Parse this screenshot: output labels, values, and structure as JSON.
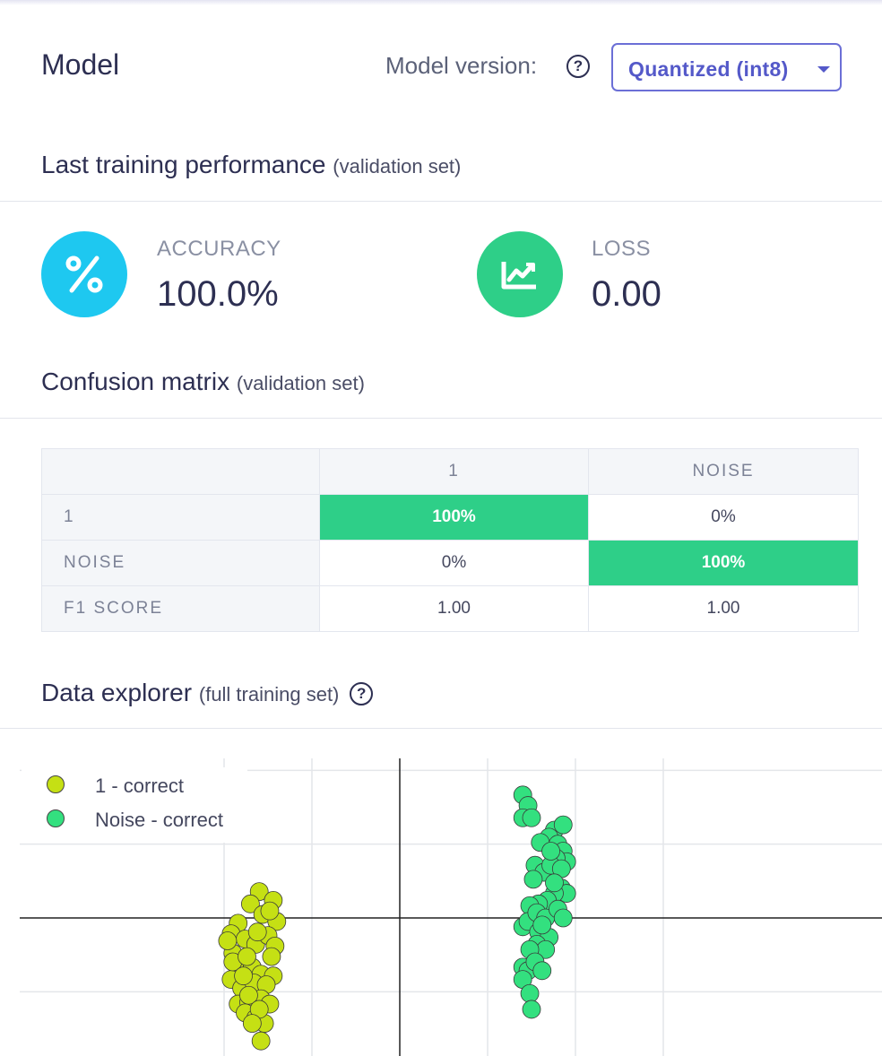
{
  "header": {
    "title": "Model",
    "model_version_label": "Model version:",
    "model_version_value": "Quantized (int8)"
  },
  "performance": {
    "title": "Last training performance",
    "subtitle": "(validation set)",
    "accuracy": {
      "label": "ACCURACY",
      "value": "100.0%",
      "icon": "percent-icon",
      "color": "#1ec8f0"
    },
    "loss": {
      "label": "LOSS",
      "value": "0.00",
      "icon": "trend-chart-icon",
      "color": "#2ecf88"
    }
  },
  "confusion_matrix": {
    "title": "Confusion matrix",
    "subtitle": "(validation set)",
    "columns": [
      "",
      "1",
      "NOISE"
    ],
    "rows": [
      {
        "label": "1",
        "values": [
          "100%",
          "0%"
        ]
      },
      {
        "label": "NOISE",
        "values": [
          "0%",
          "100%"
        ]
      },
      {
        "label": "F1 SCORE",
        "values": [
          "1.00",
          "1.00"
        ]
      }
    ],
    "highlight_color": "#2ecf88"
  },
  "data_explorer": {
    "title": "Data explorer",
    "subtitle": "(full training set)",
    "legend": [
      {
        "label": "1 - correct",
        "color": "#c5e014"
      },
      {
        "label": "Noise - correct",
        "color": "#33e07f"
      }
    ]
  },
  "chart_data": {
    "type": "scatter",
    "grid": true,
    "legend_position": "top-left",
    "series": [
      {
        "name": "1 - correct",
        "color": "#c5e014",
        "points": [
          [
            -0.8,
            0.15
          ],
          [
            -0.72,
            0.1
          ],
          [
            -0.85,
            0.08
          ],
          [
            -0.78,
            0.02
          ],
          [
            -0.7,
            -0.02
          ],
          [
            -0.92,
            -0.03
          ],
          [
            -0.96,
            -0.09
          ],
          [
            -0.88,
            -0.12
          ],
          [
            -0.82,
            -0.15
          ],
          [
            -0.75,
            -0.1
          ],
          [
            -0.71,
            -0.16
          ],
          [
            -0.73,
            -0.22
          ],
          [
            -0.95,
            -0.2
          ],
          [
            -0.91,
            -0.28
          ],
          [
            -0.84,
            -0.28
          ],
          [
            -0.79,
            -0.32
          ],
          [
            -0.72,
            -0.33
          ],
          [
            -0.96,
            -0.35
          ],
          [
            -0.9,
            -0.4
          ],
          [
            -0.83,
            -0.37
          ],
          [
            -0.76,
            -0.38
          ],
          [
            -0.92,
            -0.49
          ],
          [
            -0.86,
            -0.48
          ],
          [
            -0.79,
            -0.46
          ],
          [
            -0.74,
            -0.49
          ],
          [
            -0.88,
            -0.54
          ],
          [
            -0.82,
            -0.57
          ],
          [
            -0.77,
            -0.6
          ],
          [
            -0.79,
            -0.7
          ],
          [
            -0.86,
            -0.44
          ],
          [
            -0.95,
            -0.25
          ],
          [
            -0.87,
            -0.22
          ],
          [
            -0.81,
            -0.08
          ],
          [
            -0.74,
            0.04
          ],
          [
            -0.98,
            -0.13
          ],
          [
            -0.89,
            -0.33
          ],
          [
            -0.8,
            -0.52
          ],
          [
            -0.84,
            -0.6
          ]
        ]
      },
      {
        "name": "Noise - correct",
        "color": "#33e07f",
        "points": [
          [
            0.7,
            0.7
          ],
          [
            0.73,
            0.64
          ],
          [
            0.7,
            0.57
          ],
          [
            0.75,
            0.57
          ],
          [
            0.88,
            0.5
          ],
          [
            0.93,
            0.53
          ],
          [
            0.85,
            0.46
          ],
          [
            0.8,
            0.43
          ],
          [
            0.9,
            0.42
          ],
          [
            0.93,
            0.38
          ],
          [
            0.95,
            0.32
          ],
          [
            0.89,
            0.34
          ],
          [
            0.77,
            0.3
          ],
          [
            0.82,
            0.26
          ],
          [
            0.76,
            0.22
          ],
          [
            0.86,
            0.3
          ],
          [
            0.92,
            0.28
          ],
          [
            0.92,
            0.17
          ],
          [
            0.95,
            0.14
          ],
          [
            0.88,
            0.14
          ],
          [
            0.84,
            0.1
          ],
          [
            0.79,
            0.08
          ],
          [
            0.74,
            0.07
          ],
          [
            0.7,
            -0.05
          ],
          [
            0.73,
            -0.02
          ],
          [
            0.78,
            0.03
          ],
          [
            0.83,
            0.0
          ],
          [
            0.9,
            0.05
          ],
          [
            0.93,
            0.0
          ],
          [
            0.79,
            -0.08
          ],
          [
            0.85,
            -0.11
          ],
          [
            0.78,
            -0.15
          ],
          [
            0.83,
            -0.18
          ],
          [
            0.74,
            -0.18
          ],
          [
            0.7,
            -0.28
          ],
          [
            0.73,
            -0.3
          ],
          [
            0.77,
            -0.25
          ],
          [
            0.81,
            -0.3
          ],
          [
            0.7,
            -0.35
          ],
          [
            0.74,
            -0.43
          ],
          [
            0.75,
            -0.52
          ],
          [
            0.88,
            0.2
          ],
          [
            0.86,
            0.38
          ],
          [
            0.81,
            -0.04
          ]
        ]
      }
    ]
  }
}
